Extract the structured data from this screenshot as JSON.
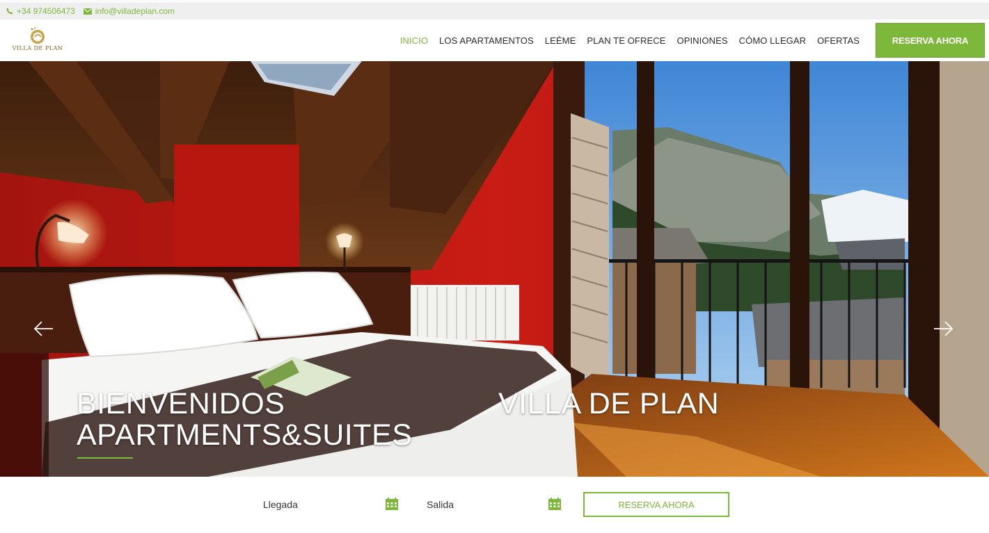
{
  "topbar": {
    "phone": "+34 974506473",
    "email": "info@villadeplan.com"
  },
  "brand": {
    "name": "VILLA DE PLAN",
    "accent_color": "#7db83a"
  },
  "nav": {
    "items": [
      {
        "label": "INICIO",
        "active": true
      },
      {
        "label": "LOS APARTAMENTOS",
        "active": false
      },
      {
        "label": "LEÉME",
        "active": false
      },
      {
        "label": "PLAN TE OFRECE",
        "active": false
      },
      {
        "label": "OPINIONES",
        "active": false
      },
      {
        "label": "CÓMO LLEGAR",
        "active": false
      },
      {
        "label": "OFERTAS",
        "active": false
      }
    ],
    "cta_label": "RESERVA AHORA"
  },
  "hero": {
    "title_left_line1": "BIENVENIDOS",
    "title_left_line2": "APARTMENTS&SUITES",
    "title_right": "VILLA DE PLAN",
    "prev_icon": "arrow-left-icon",
    "next_icon": "arrow-right-icon"
  },
  "booking": {
    "arrival_label": "Llegada",
    "departure_label": "Salida",
    "calendar_icon": "calendar-icon",
    "submit_label": "RESERVA AHORA"
  }
}
